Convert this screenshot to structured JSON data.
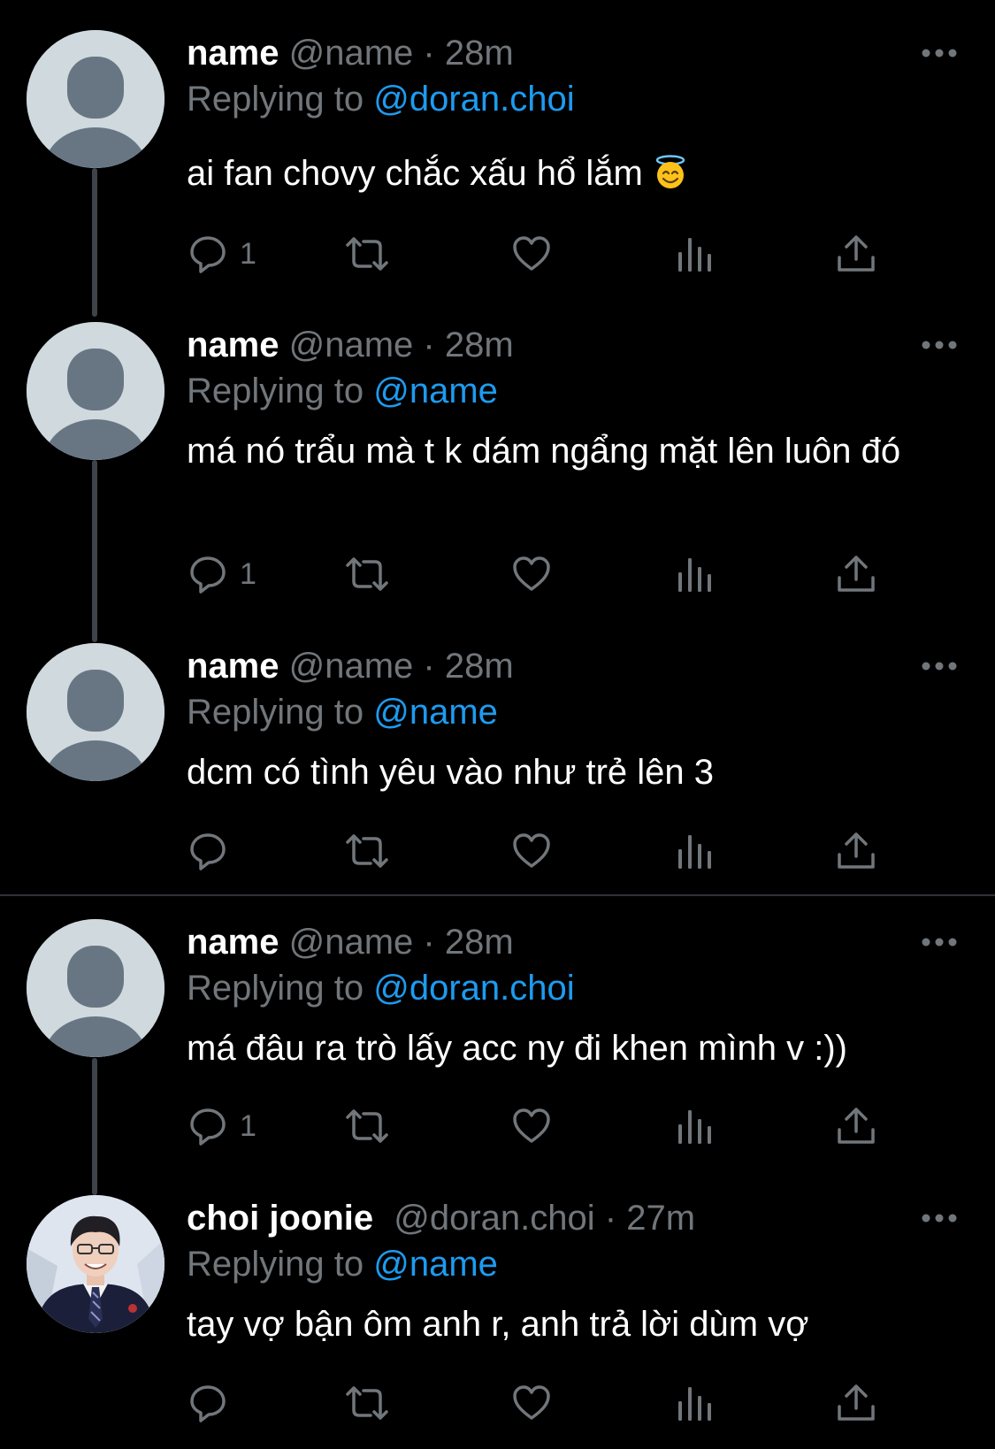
{
  "colors": {
    "background": "#000000",
    "text_primary": "#ffffff",
    "text_secondary": "#71767b",
    "link": "#1d9bf0",
    "thread_line": "#3d4349",
    "divider": "#2f3336",
    "default_avatar_bg": "#cfd9de",
    "default_avatar_fg": "#687684"
  },
  "icons": {
    "reply": "speech-bubble-icon",
    "retweet": "retweet-arrows-icon",
    "like": "heart-icon",
    "views": "bar-chart-icon",
    "share": "share-upload-icon",
    "more": "three-dots-icon",
    "emoji": "smiling-face-with-halo-emoji"
  },
  "tweets": [
    {
      "name": "name",
      "handle": "@name",
      "dot": "·",
      "time": "28m",
      "replying_label": "Replying to",
      "replying_to": "@doran.choi",
      "text": "ai fan chovy chắc xấu hổ lắm",
      "reply_count": "1"
    },
    {
      "name": "name",
      "handle": "@name",
      "dot": "·",
      "time": "28m",
      "replying_label": "Replying to",
      "replying_to": "@name",
      "text": "má nó trẩu mà t k dám ngẩng mặt lên luôn đó",
      "reply_count": "1"
    },
    {
      "name": "name",
      "handle": "@name",
      "dot": "·",
      "time": "28m",
      "replying_label": "Replying to",
      "replying_to": "@name",
      "text": "dcm có tình yêu vào như trẻ lên 3",
      "reply_count": ""
    },
    {
      "name": "name",
      "handle": "@name",
      "dot": "·",
      "time": "28m",
      "replying_label": "Replying to",
      "replying_to": "@doran.choi",
      "text": "má đâu ra trò lấy acc ny đi khen mình v :))",
      "reply_count": "1"
    },
    {
      "name": "choi joonie",
      "handle": "@doran.choi",
      "dot": "·",
      "time": "27m",
      "replying_label": "Replying to",
      "replying_to": "@name",
      "text": "tay vợ bận ôm anh r, anh trả lời dùm vợ",
      "reply_count": ""
    }
  ]
}
